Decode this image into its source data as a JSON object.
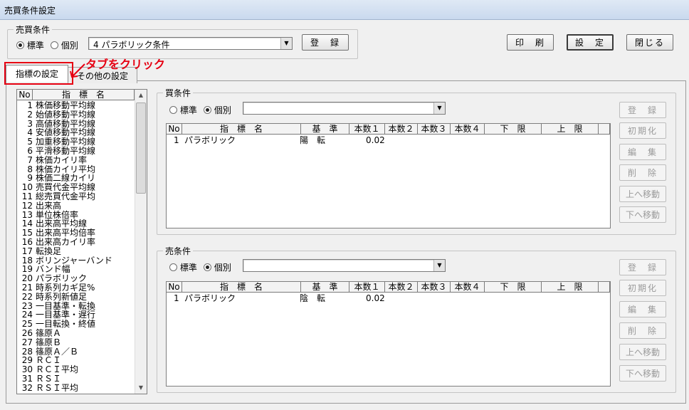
{
  "window": {
    "title": "売買条件設定"
  },
  "trade_condition": {
    "label": "売買条件",
    "radio_standard": "標準",
    "radio_individual": "個別",
    "selected": "4 パラボリック条件",
    "register_label": "登　録"
  },
  "toolbar": {
    "print_label": "印　刷",
    "settings_label": "設　定",
    "close_label": "閉じる"
  },
  "tabs": [
    {
      "label": "指標の設定"
    },
    {
      "label": "その他の設定"
    }
  ],
  "annotation": {
    "text": "タブをクリック"
  },
  "indicator_list": {
    "headers": {
      "no": "No",
      "name": "指　標　名"
    },
    "items": [
      {
        "no": "1",
        "name": "株価移動平均線"
      },
      {
        "no": "2",
        "name": "始値移動平均線"
      },
      {
        "no": "3",
        "name": "高値移動平均線"
      },
      {
        "no": "4",
        "name": "安値移動平均線"
      },
      {
        "no": "5",
        "name": "加重移動平均線"
      },
      {
        "no": "6",
        "name": "平滑移動平均線"
      },
      {
        "no": "7",
        "name": "株価カイリ率"
      },
      {
        "no": "8",
        "name": "株価カイリ平均"
      },
      {
        "no": "9",
        "name": "株価二線カイリ"
      },
      {
        "no": "10",
        "name": "売買代金平均線"
      },
      {
        "no": "11",
        "name": "総売買代金平均"
      },
      {
        "no": "12",
        "name": "出来高"
      },
      {
        "no": "13",
        "name": "単位株倍率"
      },
      {
        "no": "14",
        "name": "出来高平均線"
      },
      {
        "no": "15",
        "name": "出来高平均倍率"
      },
      {
        "no": "16",
        "name": "出来高カイリ率"
      },
      {
        "no": "17",
        "name": "転換足"
      },
      {
        "no": "18",
        "name": "ボリンジャーバンド"
      },
      {
        "no": "19",
        "name": "バンド幅"
      },
      {
        "no": "20",
        "name": "パラボリック"
      },
      {
        "no": "21",
        "name": "時系列カギ足%"
      },
      {
        "no": "22",
        "name": "時系列新値足"
      },
      {
        "no": "23",
        "name": "一目基準・転換"
      },
      {
        "no": "24",
        "name": "一目基準・遅行"
      },
      {
        "no": "25",
        "name": "一目転換・終値"
      },
      {
        "no": "26",
        "name": "篠原Ａ"
      },
      {
        "no": "27",
        "name": "篠原Ｂ"
      },
      {
        "no": "28",
        "name": "篠原Ａ／Ｂ"
      },
      {
        "no": "29",
        "name": "ＲＣＩ"
      },
      {
        "no": "30",
        "name": "ＲＣＩ平均"
      },
      {
        "no": "31",
        "name": "ＲＳＩ"
      },
      {
        "no": "32",
        "name": "ＲＳＩ平均"
      }
    ]
  },
  "buy": {
    "label": "買条件",
    "radio_standard": "標準",
    "radio_individual": "個別",
    "selected": "",
    "headers": [
      "No",
      "指　標　名",
      "基　準",
      "本数１",
      "本数２",
      "本数３",
      "本数４",
      "下　限",
      "上　限"
    ],
    "rows": [
      {
        "no": "1",
        "name": "パラボリック",
        "base": "陽　転",
        "n1": "0.02",
        "n2": "",
        "n3": "",
        "n4": "",
        "lower": "",
        "upper": ""
      }
    ],
    "buttons": {
      "register": "登　録",
      "init": "初期化",
      "edit": "編　集",
      "delete": "削　除",
      "move_up": "上へ移動",
      "move_down": "下へ移動"
    }
  },
  "sell": {
    "label": "売条件",
    "radio_standard": "標準",
    "radio_individual": "個別",
    "selected": "",
    "headers": [
      "No",
      "指　標　名",
      "基　準",
      "本数１",
      "本数２",
      "本数３",
      "本数４",
      "下　限",
      "上　限"
    ],
    "rows": [
      {
        "no": "1",
        "name": "パラボリック",
        "base": "陰　転",
        "n1": "0.02",
        "n2": "",
        "n3": "",
        "n4": "",
        "lower": "",
        "upper": ""
      }
    ],
    "buttons": {
      "register": "登　録",
      "init": "初期化",
      "edit": "編　集",
      "delete": "削　除",
      "move_up": "上へ移動",
      "move_down": "下へ移動"
    }
  }
}
